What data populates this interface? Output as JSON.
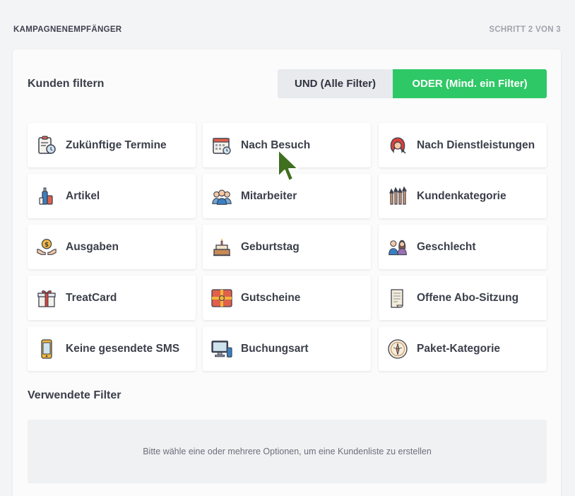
{
  "header": {
    "section_title": "KAMPAGNENEMPFÄNGER",
    "step": "SCHRITT 2 VON 3"
  },
  "filter": {
    "heading": "Kunden filtern",
    "and_label": "UND (Alle Filter)",
    "or_label": "ODER (Mind. ein Filter)",
    "active_mode": "or"
  },
  "options": [
    {
      "label": "Zukünftige Termine",
      "icon": "clipboard-clock-icon"
    },
    {
      "label": "Nach Besuch",
      "icon": "calendar-icon"
    },
    {
      "label": "Nach Dienstleistungen",
      "icon": "hairdresser-icon"
    },
    {
      "label": "Artikel",
      "icon": "cosmetics-bottles-icon"
    },
    {
      "label": "Mitarbeiter",
      "icon": "staff-group-icon"
    },
    {
      "label": "Kundenkategorie",
      "icon": "brushes-icon"
    },
    {
      "label": "Ausgaben",
      "icon": "hands-coin-icon"
    },
    {
      "label": "Geburtstag",
      "icon": "birthday-cake-icon"
    },
    {
      "label": "Geschlecht",
      "icon": "man-woman-icon"
    },
    {
      "label": "TreatCard",
      "icon": "gift-box-icon"
    },
    {
      "label": "Gutscheine",
      "icon": "voucher-icon"
    },
    {
      "label": "Offene Abo-Sitzung",
      "icon": "scroll-list-icon"
    },
    {
      "label": "Keine gesendete SMS",
      "icon": "mobile-phone-icon"
    },
    {
      "label": "Buchungsart",
      "icon": "computer-monitor-icon"
    },
    {
      "label": "Paket-Kategorie",
      "icon": "compass-badge-icon"
    }
  ],
  "used_filters": {
    "heading": "Verwendete Filter",
    "empty_text": "Bitte wähle eine oder mehrere Optionen, um eine Kundenliste zu erstellen"
  },
  "colors": {
    "accent_green": "#2ec866",
    "toggle_inactive": "#e8eaed",
    "background": "#f3f4f5"
  }
}
